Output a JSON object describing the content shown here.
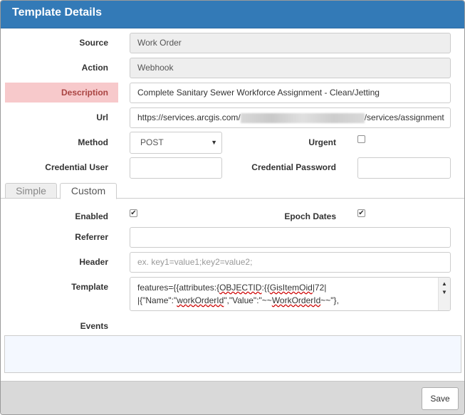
{
  "dialog": {
    "title": "Template Details"
  },
  "form": {
    "source": {
      "label": "Source",
      "value": "Work Order"
    },
    "action": {
      "label": "Action",
      "value": "Webhook"
    },
    "description": {
      "label": "Description",
      "value": "Complete Sanitary Sewer Workforce Assignment - Clean/Jetting"
    },
    "url": {
      "label": "Url",
      "prefix": "https://services.arcgis.com/",
      "suffix": "/services/assignment"
    },
    "method": {
      "label": "Method",
      "value": "POST"
    },
    "urgent": {
      "label": "Urgent",
      "checked": false
    },
    "credential_user": {
      "label": "Credential User",
      "value": ""
    },
    "credential_password": {
      "label": "Credential Password",
      "value": ""
    }
  },
  "tabs": [
    {
      "label": "Simple",
      "active": false
    },
    {
      "label": "Custom",
      "active": true
    }
  ],
  "custom": {
    "enabled": {
      "label": "Enabled",
      "checked": true
    },
    "epoch_dates": {
      "label": "Epoch Dates",
      "checked": true
    },
    "referrer": {
      "label": "Referrer",
      "value": ""
    },
    "header": {
      "label": "Header",
      "placeholder": "ex. key1=value1;key2=value2;"
    },
    "template": {
      "label": "Template",
      "line1": {
        "a": "features={{attributes:{",
        "b": "OBJECTID",
        "c": ":{{",
        "d": "GisItemOid",
        "e": "|72|"
      },
      "line2": {
        "a": "|{\"Name\":\"",
        "b": "workOrderId",
        "c": "\",\"Value\":\"~~",
        "d": "WorkOrderId",
        "e": "~~\"},"
      }
    },
    "events": {
      "label": "Events"
    }
  },
  "footer": {
    "save_label": "Save"
  },
  "icons": {
    "select_caret": "▼",
    "checkmark": "✔",
    "scroll_up": "▲",
    "scroll_down": "▼"
  }
}
